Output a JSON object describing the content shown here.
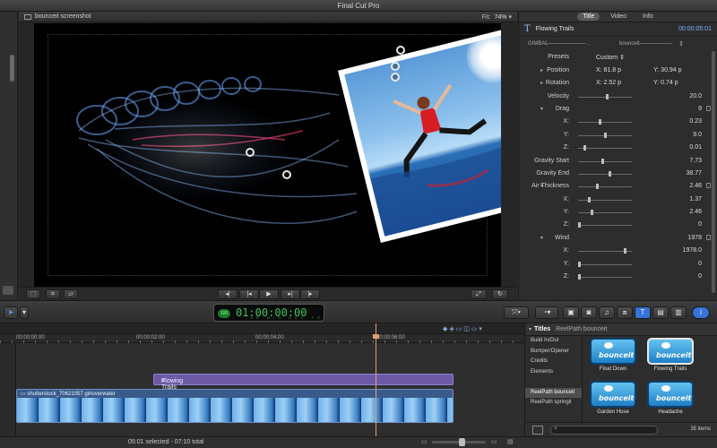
{
  "app": {
    "title": "Final Cut Pro"
  },
  "viewer": {
    "clip_title": "bounceit screenshot",
    "fit_label": "Fit:",
    "fit_value": "74%"
  },
  "inspector": {
    "tabs": [
      {
        "label": "Title"
      },
      {
        "label": "Video"
      },
      {
        "label": "Info"
      }
    ],
    "active_tab": "Title",
    "effect_name": "Flowing Trails",
    "timecode": "00:00:05:01",
    "gimbal_left": "GIMBAL——————— .",
    "gimbal_right": "bounceit——————",
    "presets_label": "Presets",
    "presets_value": "Custom",
    "params": [
      {
        "label": "Position",
        "x": "X:  81.8  p",
        "y": "Y:  30.94  p"
      },
      {
        "label": "Rotation",
        "x": "X:  2.52  p",
        "y": "Y:  0.74  p"
      }
    ],
    "rows": [
      {
        "label": "Velocity",
        "value": "20.0",
        "tri": false,
        "knob": 0.55
      },
      {
        "label": "Drag",
        "value": "9",
        "tri": true,
        "knob": -1
      },
      {
        "label": "X:",
        "value": "0.23",
        "tri": false,
        "knob": 0.4
      },
      {
        "label": "Y:",
        "value": "9.0",
        "tri": false,
        "knob": 0.5
      },
      {
        "label": "Z:",
        "value": "0.01",
        "tri": false,
        "knob": 0.1
      },
      {
        "label": "Gravity Start",
        "value": "7.73",
        "tri": false,
        "knob": 0.45
      },
      {
        "label": "Gravity End",
        "value": "38.77",
        "tri": false,
        "knob": 0.6
      },
      {
        "label": "Air Thickness",
        "value": "2.46",
        "tri": true,
        "knob": 0.35
      },
      {
        "label": "X:",
        "value": "1.37",
        "tri": false,
        "knob": 0.2
      },
      {
        "label": "Y:",
        "value": "2.46",
        "tri": false,
        "knob": 0.25
      },
      {
        "label": "Z:",
        "value": "0",
        "tri": false,
        "knob": 0.0
      },
      {
        "label": "Wind",
        "value": "1978",
        "tri": true,
        "knob": -1
      },
      {
        "label": "X:",
        "value": "1978.0",
        "tri": false,
        "knob": 0.9
      },
      {
        "label": "Y:",
        "value": "0",
        "tri": false,
        "knob": 0.0
      },
      {
        "label": "Z:",
        "value": "0",
        "tri": false,
        "knob": 0.0
      }
    ]
  },
  "toolbar": {
    "timecode": "01:00:00:00",
    "timecode_percent": "100",
    "timecode_sub": "HR MIN SEC FR"
  },
  "timeline": {
    "ruler": [
      "00:00:00:00",
      "00:00:02:00",
      "00:00:04:00",
      "00:00:06:00"
    ],
    "title_clip": "Flowing Trails",
    "video_clip": "shutterstock_70621057 girloverwater"
  },
  "browser": {
    "header_title": "Titles",
    "header_sub": "ReelPath bounceit",
    "categories": [
      {
        "label": "Build In/Out",
        "selected": false
      },
      {
        "label": "Bumper/Opener",
        "selected": false
      },
      {
        "label": "Credits",
        "selected": false
      },
      {
        "label": "Elements",
        "selected": false
      },
      {
        "label": "",
        "selected": false
      },
      {
        "label": "ReelPath bounceit",
        "selected": true
      },
      {
        "label": "ReelPath springit",
        "selected": false
      }
    ],
    "tiles": [
      {
        "caption": "Float Down",
        "logo": "bounceit",
        "selected": false
      },
      {
        "caption": "Flowing Trails",
        "logo": "bounceit",
        "selected": true
      },
      {
        "caption": "Garden Hose",
        "logo": "bounceit",
        "selected": false
      },
      {
        "caption": "Headache",
        "logo": "bounceit",
        "selected": false
      }
    ],
    "items_count": "35 items"
  },
  "status": {
    "selection": "05:01 selected - 07:10 total"
  },
  "colors": {
    "accent": "#3672d8",
    "timecode_green": "#3cc45a",
    "title_clip": "#6c5aa6",
    "video_clip": "#3a5b8a",
    "playhead": "#e0a070"
  }
}
